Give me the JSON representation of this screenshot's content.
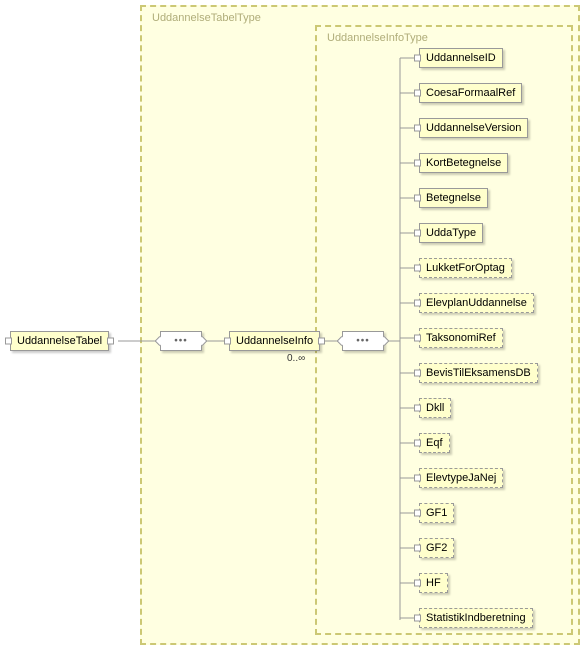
{
  "boxes": {
    "outer": {
      "label": "UddannelseTabelType"
    },
    "inner": {
      "label": "UddannelseInfoType"
    }
  },
  "root": {
    "label": "UddannelseTabel"
  },
  "level2": {
    "label": "UddannelseInfo",
    "cardinality": "0..∞"
  },
  "leaves": [
    {
      "label": "UddannelseID",
      "dashed": false
    },
    {
      "label": "CoesaFormaalRef",
      "dashed": false
    },
    {
      "label": "UddannelseVersion",
      "dashed": false
    },
    {
      "label": "KortBetegnelse",
      "dashed": false
    },
    {
      "label": "Betegnelse",
      "dashed": false
    },
    {
      "label": "UddaType",
      "dashed": false
    },
    {
      "label": "LukketForOptag",
      "dashed": true
    },
    {
      "label": "ElevplanUddannelse",
      "dashed": true
    },
    {
      "label": "TaksonomiRef",
      "dashed": true
    },
    {
      "label": "BevisTilEksamensDB",
      "dashed": true
    },
    {
      "label": "Dkll",
      "dashed": true
    },
    {
      "label": "Eqf",
      "dashed": true
    },
    {
      "label": "ElevtypeJaNej",
      "dashed": true
    },
    {
      "label": "GF1",
      "dashed": true
    },
    {
      "label": "GF2",
      "dashed": true
    },
    {
      "label": "HF",
      "dashed": true
    },
    {
      "label": "StatistikIndberetning",
      "dashed": true
    }
  ],
  "chart_data": {
    "type": "table",
    "title": "XSD schema diagram",
    "root_element": "UddannelseTabel",
    "root_type": "UddannelseTabelType",
    "sequence": [
      {
        "element": "UddannelseInfo",
        "type": "UddannelseInfoType",
        "min_occurs": 0,
        "max_occurs": "unbounded",
        "sequence": [
          {
            "element": "UddannelseID",
            "optional": false
          },
          {
            "element": "CoesaFormaalRef",
            "optional": false
          },
          {
            "element": "UddannelseVersion",
            "optional": false
          },
          {
            "element": "KortBetegnelse",
            "optional": false
          },
          {
            "element": "Betegnelse",
            "optional": false
          },
          {
            "element": "UddaType",
            "optional": false
          },
          {
            "element": "LukketForOptag",
            "optional": true
          },
          {
            "element": "ElevplanUddannelse",
            "optional": true
          },
          {
            "element": "TaksonomiRef",
            "optional": true
          },
          {
            "element": "BevisTilEksamensDB",
            "optional": true
          },
          {
            "element": "Dkll",
            "optional": true
          },
          {
            "element": "Eqf",
            "optional": true
          },
          {
            "element": "ElevtypeJaNej",
            "optional": true
          },
          {
            "element": "GF1",
            "optional": true
          },
          {
            "element": "GF2",
            "optional": true
          },
          {
            "element": "HF",
            "optional": true
          },
          {
            "element": "StatistikIndberetning",
            "optional": true
          }
        ]
      }
    ]
  }
}
